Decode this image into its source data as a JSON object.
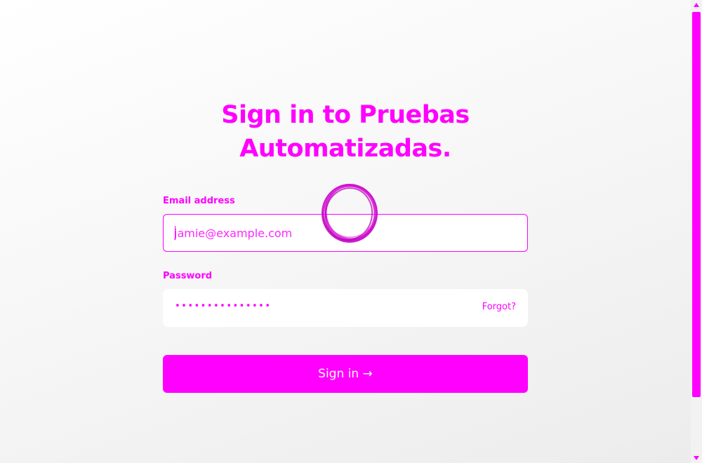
{
  "theme": {
    "accent_color": "#ff00ff",
    "button_text_color": "#ffffff",
    "background_color": "#f5f5f5"
  },
  "header": {
    "title_line1": "Sign in to Pruebas",
    "title_line2": "Automatizadas."
  },
  "form": {
    "email": {
      "label": "Email address",
      "value": "",
      "placeholder": "jamie@example.com"
    },
    "password": {
      "label": "Password",
      "masked_value": "•••••••••••••••",
      "forgot_label": "Forgot?"
    },
    "submit_label": "Sign in →"
  },
  "overlay": {
    "click_marker_icon": "hand-drawn-circle-marker"
  }
}
